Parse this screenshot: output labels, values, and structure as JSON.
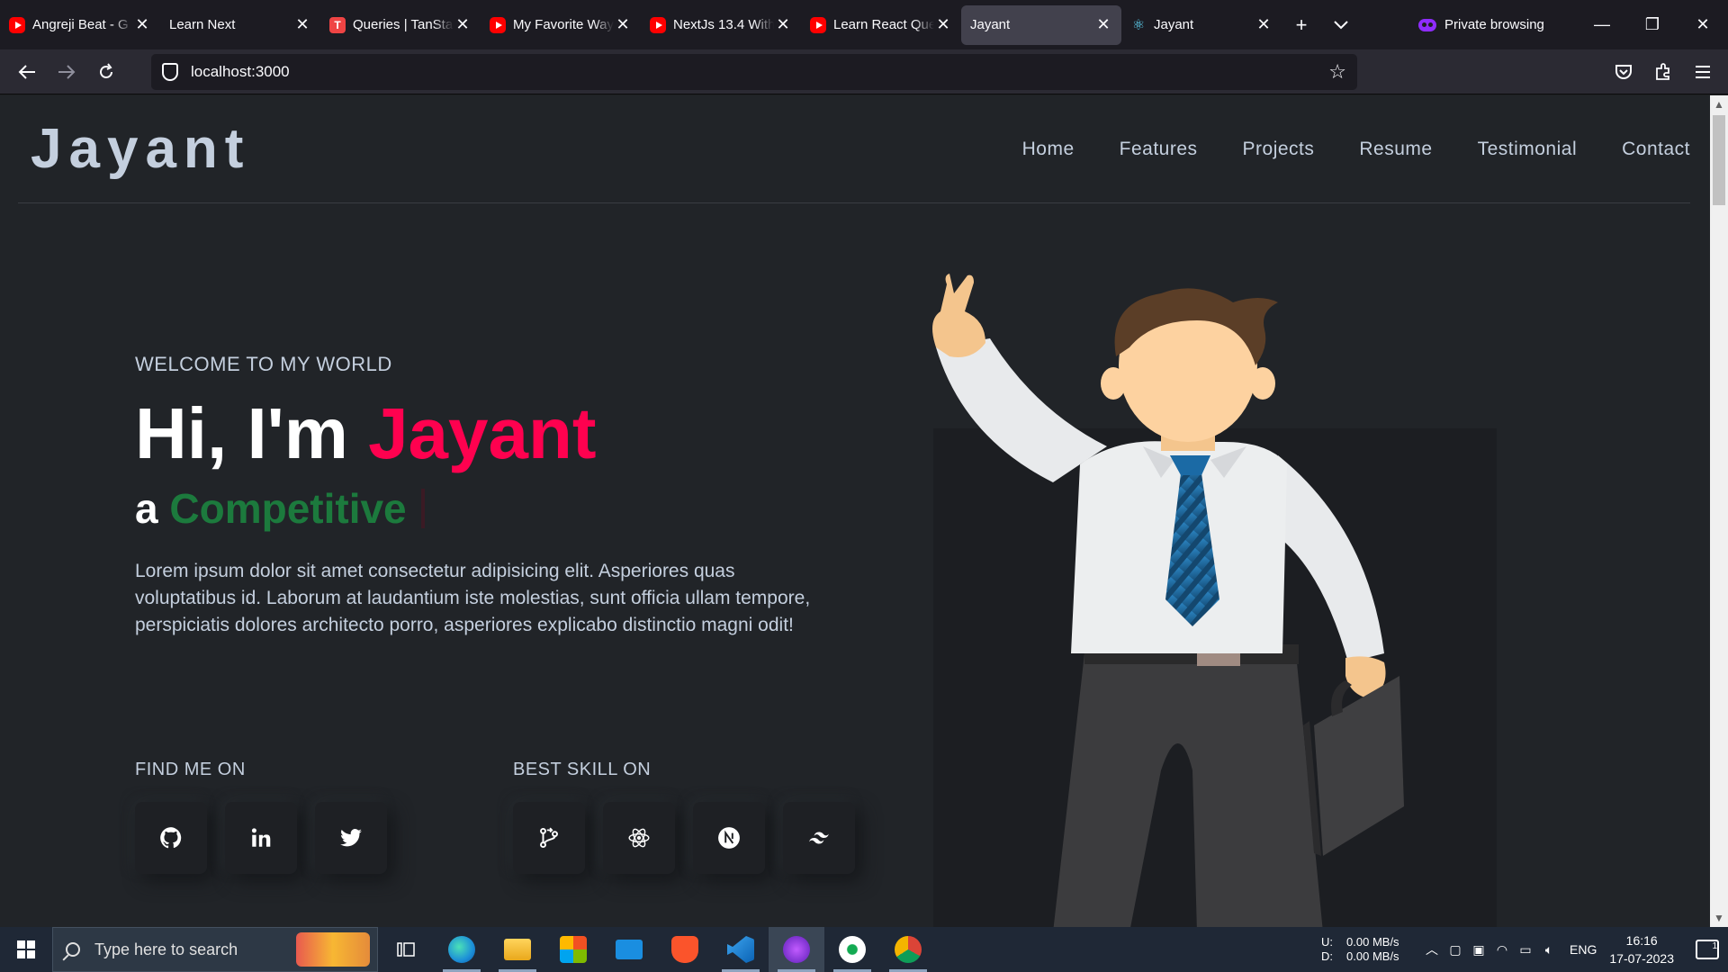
{
  "browser": {
    "tabs": [
      {
        "title": "Angreji Beat - G",
        "favicon": "youtube-icon",
        "active": false
      },
      {
        "title": "Learn Next",
        "favicon": "none",
        "active": false
      },
      {
        "title": "Queries | TanSta",
        "favicon": "tanstack-icon",
        "active": false
      },
      {
        "title": "My Favorite Way",
        "favicon": "youtube-icon",
        "active": false
      },
      {
        "title": "NextJs 13.4 With",
        "favicon": "youtube-icon",
        "active": false
      },
      {
        "title": "Learn React Que",
        "favicon": "youtube-icon",
        "active": false
      },
      {
        "title": "Jayant",
        "favicon": "none",
        "active": true
      },
      {
        "title": "Jayant",
        "favicon": "react-icon",
        "active": false
      }
    ],
    "private_label": "Private browsing",
    "url": "localhost:3000"
  },
  "site": {
    "logo": "Jayant",
    "menu": [
      "Home",
      "Features",
      "Projects",
      "Resume",
      "Testimonial",
      "Contact"
    ],
    "welcome": "WELCOME TO MY WORLD",
    "greeting": "Hi, I'm ",
    "name": "Jayant",
    "role_prefix": "a ",
    "role_word": "Competitive",
    "description": "Lorem ipsum dolor sit amet consectetur adipisicing elit. Asperiores quas voluptatibus id. Laborum at laudantium iste molestias, sunt officia ullam tempore, perspiciatis dolores architecto porro, asperiores explicabo distinctio magni odit!",
    "find_me_label": "FIND ME ON",
    "skills_label": "BEST SKILL ON",
    "social": [
      "github-icon",
      "linkedin-icon",
      "twitter-icon"
    ],
    "skills": [
      "git-icon",
      "react-icon",
      "nextjs-icon",
      "tailwind-icon"
    ],
    "colors": {
      "accent": "#ff014f",
      "role": "#1c7a3d",
      "bg": "#212428"
    }
  },
  "taskbar": {
    "search_placeholder": "Type here to search",
    "net_upload_label": "U:",
    "net_upload": "0.00 MB/s",
    "net_download_label": "D:",
    "net_download": "0.00 MB/s",
    "language": "ENG",
    "time": "16:16",
    "date": "17-07-2023",
    "notifications": "1"
  }
}
